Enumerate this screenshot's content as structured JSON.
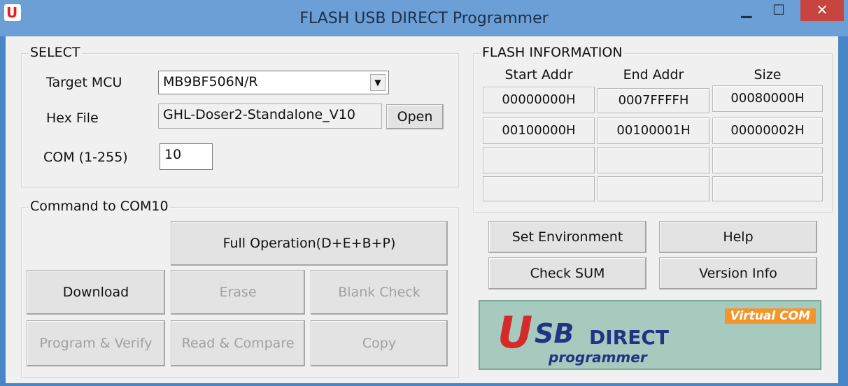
{
  "window": {
    "title": "FLASH USB DIRECT Programmer",
    "app_icon_letter": "U",
    "min_glyph": "▁",
    "max_glyph": "☐",
    "close_glyph": "✕"
  },
  "select_group": {
    "legend": "SELECT",
    "target_mcu_label": "Target MCU",
    "target_mcu_value": "MB9BF506N/R",
    "hex_file_label": "Hex File",
    "hex_file_value": "GHL-Doser2-Standalone_V10",
    "open_button": "Open",
    "com_label": "COM (1-255)",
    "com_value": "10"
  },
  "command_group": {
    "legend": "Command to COM10",
    "full_operation": "Full Operation(D+E+B+P)",
    "download": "Download",
    "erase": "Erase",
    "blank_check": "Blank Check",
    "program_verify": "Program & Verify",
    "read_compare": "Read & Compare",
    "copy": "Copy"
  },
  "flash_info": {
    "legend": "FLASH INFORMATION",
    "headers": [
      "Start Addr",
      "End Addr",
      "Size"
    ],
    "rows": [
      [
        "00000000H",
        "0007FFFFH",
        "00080000H"
      ],
      [
        "00100000H",
        "00100001H",
        "00000002H"
      ],
      [
        "",
        "",
        ""
      ],
      [
        "",
        "",
        ""
      ]
    ]
  },
  "side_buttons": {
    "set_environment": "Set Environment",
    "help": "Help",
    "check_sum": "Check SUM",
    "version_info": "Version Info"
  },
  "logo": {
    "badge": "Virtual COM",
    "u": "U",
    "sb": "SB",
    "direct": "DIRECT",
    "programmer": "programmer"
  }
}
